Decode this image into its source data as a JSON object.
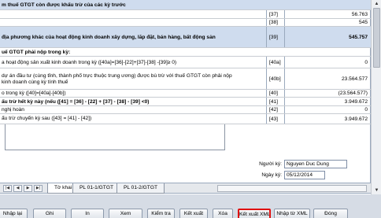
{
  "rows": [
    {
      "label": "m thuế GTGT còn được khấu trừ của các kỳ trước",
      "code": "",
      "value": "",
      "header": true,
      "bold": true
    },
    {
      "label": "",
      "code": "[37]",
      "value": "56.763",
      "header": false,
      "bold": false
    },
    {
      "label": "",
      "code": "[38]",
      "value": "545",
      "header": false,
      "bold": false
    },
    {
      "label": "địa phương khác của hoạt động kinh doanh xây dựng, lắp đặt, bán hàng, bất động sản",
      "code": "[39]",
      "value": "545.757",
      "header": true,
      "bold": true
    },
    {
      "label": "uế GTGT phải nộp trong kỳ:",
      "code": "",
      "value": "",
      "header": false,
      "bold": true
    },
    {
      "label": "a hoạt động sản xuất kinh doanh trong kỳ ([40a]=[36]-[22]+[37]-[38] -[39]≥ 0)",
      "code": "[40a]",
      "value": "0",
      "header": false,
      "bold": false
    },
    {
      "label": "dự án đầu tư (cùng tỉnh, thành phố trực thuộc trung ương) được bù trừ với thuế GTGT còn phải nộp\n kinh doanh cùng kỳ tính thuế",
      "code": "[40b]",
      "value": "23.564.577",
      "header": false,
      "bold": false
    },
    {
      "label": "o trong kỳ ([40]=[40a]-[40b])",
      "code": "[40]",
      "value": "(23.564.577)",
      "header": false,
      "bold": false
    },
    {
      "label": "ấu trừ hết kỳ này (nếu ([41] = [36] - [22] + [37] - [38] - [39] <0)",
      "code": "[41]",
      "value": "3.949.672",
      "header": false,
      "bold": true
    },
    {
      "label": "nghị hoàn",
      "code": "[42]",
      "value": "0",
      "header": false,
      "bold": false
    },
    {
      "label": "ấu trừ chuyển kỳ sau ([43] = [41] - [42])",
      "code": "[43]",
      "value": "3.949.672",
      "header": false,
      "bold": false
    }
  ],
  "signature": {
    "signer_label": "Người ký:",
    "signer_value": "Nguyen Duc Dung",
    "date_label": "Ngày ký:",
    "date_value": "05/12/2014"
  },
  "tabs": [
    "Tờ khai",
    "PL 01-1/GTGT",
    "PL 01-2/GTGT"
  ],
  "nav_icons": [
    "first-icon",
    "prev-icon",
    "next-icon",
    "last-icon"
  ],
  "buttons": [
    {
      "label": "Nhập lại",
      "highlighted": false
    },
    {
      "label": "Ghi",
      "highlighted": false
    },
    {
      "label": "In",
      "highlighted": false
    },
    {
      "label": "Xem",
      "highlighted": false
    },
    {
      "label": "Kiểm tra",
      "highlighted": false
    },
    {
      "label": "Kết xuất",
      "highlighted": false
    },
    {
      "label": "Xóa",
      "highlighted": false
    },
    {
      "label": "Kết xuất XML",
      "highlighted": true
    },
    {
      "label": "Nhập từ XML",
      "highlighted": false
    },
    {
      "label": "Đóng",
      "highlighted": false
    }
  ],
  "colors": {
    "header_row": "#cfdcee",
    "button_bar": "#d6dce5",
    "highlight": "#e01010"
  }
}
